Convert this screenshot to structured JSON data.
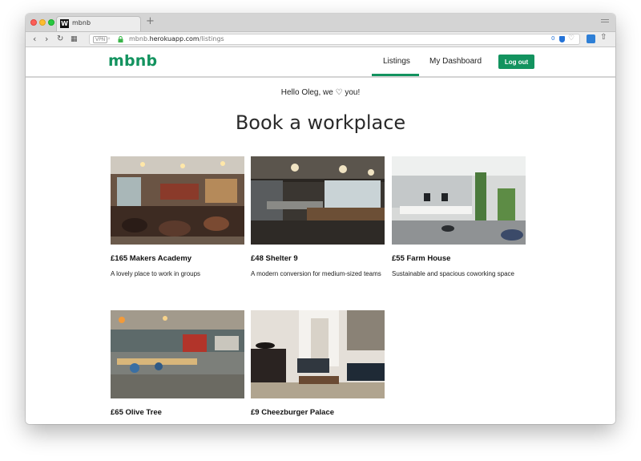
{
  "browser": {
    "tab_title": "mbnb",
    "favicon_letter": "W",
    "new_tab_symbol": "+",
    "url_domain": "mbnb.",
    "url_host": "herokuapp.com",
    "url_path": "/listings",
    "vpn_label": "VPN",
    "ext_count": "0",
    "icons": [
      "close-traffic-light",
      "minimize-traffic-light",
      "zoom-traffic-light",
      "back-icon",
      "forward-icon",
      "reload-icon",
      "grid-icon",
      "lock-icon",
      "heart-icon",
      "share-icon"
    ]
  },
  "site": {
    "brand": "mbnb",
    "accent_color": "#13935f",
    "nav": {
      "listings": "Listings",
      "dashboard": "My Dashboard",
      "logout": "Log out"
    }
  },
  "main": {
    "greeting": "Hello Oleg, we ♡ you!",
    "title": "Book a workplace",
    "listings": [
      {
        "title": "£165 Makers Academy",
        "description": "A lovely place to work in groups",
        "image": "cafe-workspace-photo"
      },
      {
        "title": "£48 Shelter 9",
        "description": "A modern conversion for medium-sized teams",
        "image": "industrial-hall-photo"
      },
      {
        "title": "£55 Farm House",
        "description": "Sustainable and spacious coworking space",
        "image": "open-office-photo"
      },
      {
        "title": "£65 Olive Tree",
        "description": "",
        "image": "coworking-desks-photo"
      },
      {
        "title": "£9 Cheezburger Palace",
        "description": "",
        "image": "lounge-photo"
      }
    ]
  }
}
